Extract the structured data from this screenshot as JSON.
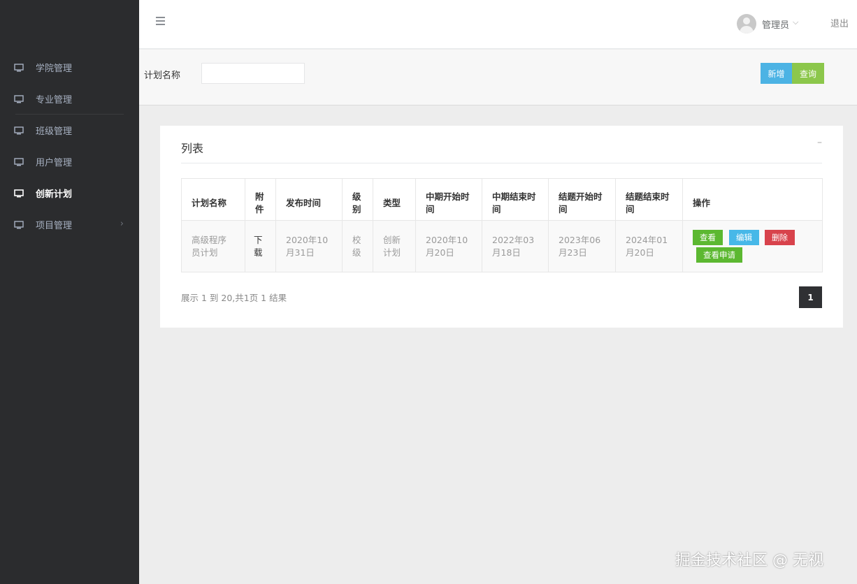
{
  "sidebar": {
    "items": [
      {
        "label": "学院管理",
        "icon": "monitor-icon",
        "active": false
      },
      {
        "label": "专业管理",
        "icon": "monitor-icon",
        "active": false
      },
      {
        "label": "班级管理",
        "icon": "monitor-icon",
        "active": false
      },
      {
        "label": "用户管理",
        "icon": "monitor-icon",
        "active": false
      },
      {
        "label": "创新计划",
        "icon": "monitor-icon",
        "active": true
      },
      {
        "label": "项目管理",
        "icon": "monitor-icon",
        "active": false,
        "has_submenu": true
      }
    ]
  },
  "header": {
    "menu_icon": "hamburger-icon",
    "user": "管理员",
    "logout": "退出"
  },
  "search": {
    "label": "计划名称",
    "value": "",
    "add_button": "新增",
    "query_button": "查询",
    "colors": {
      "add": "#4cb3e4",
      "query": "#8cc74b"
    }
  },
  "panel": {
    "title": "列表",
    "collapse": "–"
  },
  "table": {
    "headers": [
      "计划名称",
      "附件",
      "发布时间",
      "级别",
      "类型",
      "中期开始时间",
      "中期结束时间",
      "结题开始时间",
      "结题结束时间",
      "操作"
    ],
    "rows": [
      {
        "name": "高级程序员计划",
        "attachment": "下载",
        "publish_time": "2020年10月31日",
        "level": "校级",
        "type": "创新计划",
        "mid_start": "2020年10月20日",
        "mid_end": "2022年03月18日",
        "final_start": "2023年06月23日",
        "final_end": "2024年01月20日",
        "actions": {
          "view": "查看",
          "edit": "编辑",
          "delete": "删除",
          "apply": "查看申请"
        }
      }
    ]
  },
  "pagination": {
    "info": "展示 1 到 20,共1页 1 结果",
    "current_page": "1"
  },
  "watermark": "掘金技术社区 @ 无视"
}
